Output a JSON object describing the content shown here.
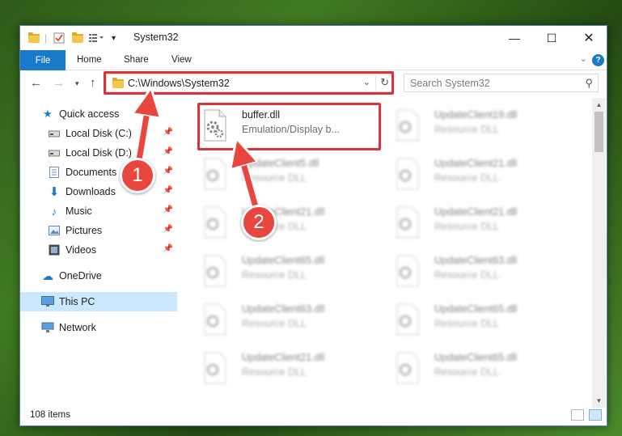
{
  "window": {
    "title": "System32"
  },
  "ribbon": {
    "file_label": "File",
    "tabs": [
      "Home",
      "Share",
      "View"
    ]
  },
  "nav": {
    "address": "C:\\Windows\\System32",
    "search_placeholder": "Search System32"
  },
  "sidebar": {
    "items": [
      {
        "label": "Quick access",
        "icon": "star-icon"
      },
      {
        "label": "Local Disk (C:)",
        "icon": "drive-icon",
        "pinned": true
      },
      {
        "label": "Local Disk (D:)",
        "icon": "drive-icon",
        "pinned": true
      },
      {
        "label": "Documents",
        "icon": "documents-icon",
        "pinned": true
      },
      {
        "label": "Downloads",
        "icon": "download-arrow-icon",
        "pinned": true
      },
      {
        "label": "Music",
        "icon": "music-note-icon",
        "pinned": true
      },
      {
        "label": "Pictures",
        "icon": "pictures-icon",
        "pinned": true
      },
      {
        "label": "Videos",
        "icon": "film-icon",
        "pinned": true
      },
      {
        "label": "OneDrive",
        "icon": "cloud-icon"
      },
      {
        "label": "This PC",
        "icon": "monitor-icon",
        "selected": true
      },
      {
        "label": "Network",
        "icon": "network-icon"
      }
    ]
  },
  "files": [
    {
      "name": "buffer.dll",
      "desc": "Emulation/Display b...",
      "highlighted": true
    },
    {
      "name": "UpdateClient19.dll",
      "desc": "Resource DLL"
    },
    {
      "name": "UpdateClient5.dll",
      "desc": "Resource DLL"
    },
    {
      "name": "UpdateClient21.dll",
      "desc": "Resource DLL"
    },
    {
      "name": "UpdateClient21.dll",
      "desc": "Resource DLL"
    },
    {
      "name": "UpdateClient21.dll",
      "desc": "Resource DLL"
    },
    {
      "name": "UpdateClient65.dll",
      "desc": "Resource DLL"
    },
    {
      "name": "UpdateClient63.dll",
      "desc": "Resource DLL"
    },
    {
      "name": "UpdateClient63.dll",
      "desc": "Resource DLL"
    },
    {
      "name": "UpdateClient65.dll",
      "desc": "Resource DLL"
    },
    {
      "name": "UpdateClient21.dll",
      "desc": "Resource DLL"
    },
    {
      "name": "UpdateClient65.dll",
      "desc": "Resource DLL"
    }
  ],
  "status": {
    "item_count": "108 items"
  },
  "callouts": [
    "1",
    "2"
  ],
  "colors": {
    "accent": "#1979ca",
    "highlight": "#d8323a",
    "callout": "#e8463f",
    "selected": "#cce8ff"
  }
}
